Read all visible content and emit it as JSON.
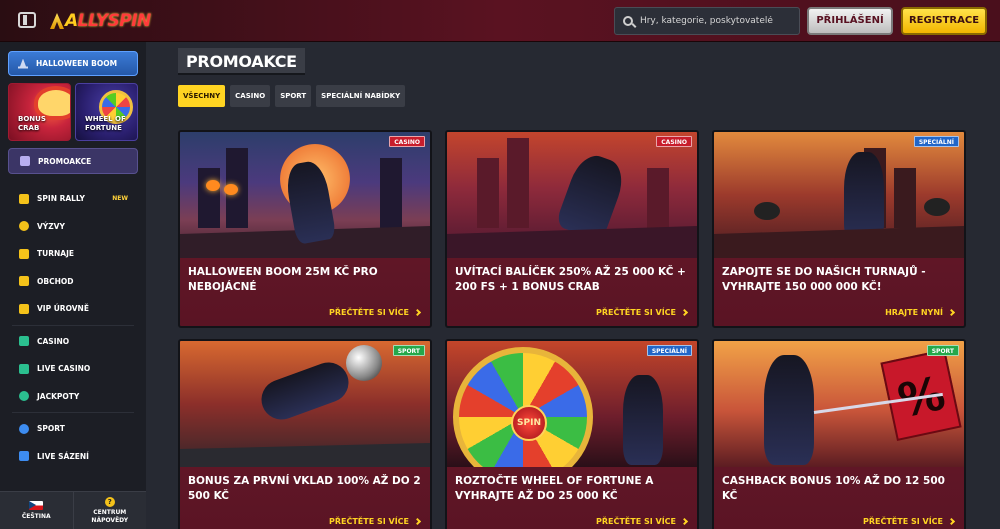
{
  "header": {
    "logo_first": "A",
    "logo_rest": "LLYSPIN",
    "search_placeholder": "Hry, kategorie, poskytovatelé",
    "login_label": "PŘIHLÁŠENÍ",
    "register_label": "REGISTRACE"
  },
  "sidebar": {
    "halloween_label": "HALLOWEEN BOOM",
    "tiles": [
      {
        "label_line1": "BONUS",
        "label_line2": "CRAB"
      },
      {
        "label_line1": "WHEEL OF",
        "label_line2": "FORTUNE"
      }
    ],
    "promo_label": "PROMOAKCE",
    "group1": [
      {
        "label": "SPIN RALLY",
        "badge": "NEW",
        "icon": "lightning-icon"
      },
      {
        "label": "VÝZVY",
        "icon": "medal-icon"
      },
      {
        "label": "TURNAJE",
        "icon": "trophy-icon"
      },
      {
        "label": "OBCHOD",
        "icon": "cart-icon"
      },
      {
        "label": "VIP ÚROVNĚ",
        "icon": "diamond-icon"
      }
    ],
    "group2": [
      {
        "label": "CASINO",
        "icon": "slot-icon"
      },
      {
        "label": "LIVE CASINO",
        "icon": "live-dealer-icon"
      },
      {
        "label": "JACKPOTY",
        "icon": "clover-icon"
      }
    ],
    "group3": [
      {
        "label": "SPORT",
        "icon": "ball-icon"
      },
      {
        "label": "LIVE SÁZENÍ",
        "icon": "live-tv-icon"
      }
    ],
    "footer": {
      "language": "ČEŠTINA",
      "help_line1": "CENTRUM",
      "help_line2": "NÁPOVĚDY"
    }
  },
  "main": {
    "title": "PROMOAKCE",
    "tabs": [
      "VŠECHNY",
      "CASINO",
      "SPORT",
      "SPECIÁLNÍ NABÍDKY"
    ],
    "cards": [
      {
        "badge": "CASINO",
        "title": "HALLOWEEN BOOM 25M KČ PRO NEBOJÁCNÉ",
        "link": "PŘEČTĚTE SI VÍCE"
      },
      {
        "badge": "CASINO",
        "title": "UVÍTACÍ BALÍČEK 250% AŽ 25 000 KČ + 200 FS + 1 BONUS CRAB",
        "link": "PŘEČTĚTE SI VÍCE"
      },
      {
        "badge": "SPECIÁLNÍ",
        "title": "ZAPOJTE SE DO NAŠICH TURNAJŮ - VYHRAJTE 150 000 000 KČ!",
        "link": "HRAJTE NYNÍ"
      },
      {
        "badge": "SPORT",
        "title": "BONUS ZA PRVNÍ VKLAD 100% AŽ DO 2 500 KČ",
        "link": "PŘEČTĚTE SI VÍCE"
      },
      {
        "badge": "SPECIÁLNÍ",
        "title": "ROZTOČTE WHEEL OF FORTUNE A VYHRAJTE AŽ DO 25 000 KČ",
        "link": "PŘEČTĚTE SI VÍCE"
      },
      {
        "badge": "SPORT",
        "title": "CASHBACK BONUS 10% AŽ DO 12 500 KČ",
        "link": "PŘEČTĚTE SI VÍCE"
      }
    ],
    "wheel_hub_text": "SPIN",
    "cashback_sign": "%"
  },
  "colors": {
    "accent_yellow": "#ffd422",
    "card_bg": "#5a1424",
    "badge_casino": "#c81d2c",
    "badge_special": "#2166c8",
    "badge_sport": "#24a84a"
  }
}
